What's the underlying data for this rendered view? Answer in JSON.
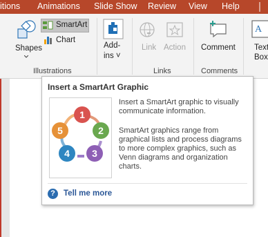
{
  "tabs": {
    "transitions": "itions",
    "animations": "Animations",
    "slideshow": "Slide Show",
    "review": "Review",
    "view": "View",
    "help": "Help"
  },
  "ribbon": {
    "shapes_label": "Shapes",
    "smartart_label": "SmartArt",
    "chart_label": "Chart",
    "addins_label_1": "Add-",
    "addins_label_2": "ins ˅",
    "link_label": "Link",
    "action_label": "Action",
    "comment_label": "Comment",
    "textbox_label_1": "Text",
    "textbox_label_2": "Box",
    "group_illustrations": "Illustrations",
    "group_links": "Links",
    "group_comments": "Comments"
  },
  "tooltip": {
    "title": "Insert a SmartArt Graphic",
    "para1_line1": "Insert a SmartArt graphic to visually",
    "para1_line2": "communicate information.",
    "para2_line1": "SmartArt graphics range from",
    "para2_line2": "graphical lists and process diagrams",
    "para2_line3": "to more complex graphics, such as",
    "para2_line4": "Venn diagrams and organization",
    "para2_line5": "charts.",
    "link": "Tell me more",
    "cycle_numbers": [
      "1",
      "2",
      "3",
      "4",
      "5"
    ]
  },
  "colors": {
    "tab_bar": "#b7472a",
    "cycle_1": "#d9534f",
    "cycle_2": "#6aa84f",
    "cycle_3": "#8e5fb5",
    "cycle_4": "#2e86c1",
    "cycle_5": "#e69138"
  },
  "icons": {
    "shapes": "shapes-icon",
    "smartart": "smartart-icon",
    "chart": "chart-icon",
    "addins": "addins-icon",
    "link": "link-icon",
    "action": "action-icon",
    "comment": "comment-icon",
    "textbox": "textbox-icon",
    "help": "help-icon"
  }
}
